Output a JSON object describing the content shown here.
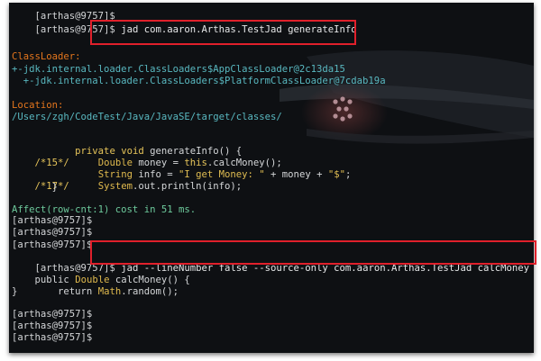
{
  "terminal": {
    "lines": [
      {
        "t": "[arthas@9757]$"
      },
      {
        "t": "[arthas@9757]$ jad com.aaron.Arthas.TestJad generateInfo"
      },
      {
        "t": ""
      },
      {
        "t": "ClassLoader:"
      },
      {
        "t": "+-jdk.internal.loader.ClassLoaders$AppClassLoader@2c13da15"
      },
      {
        "t": "  +-jdk.internal.loader.ClassLoaders$PlatformClassLoader@7cdab19a"
      },
      {
        "t": ""
      },
      {
        "t": "Location:"
      },
      {
        "t": "/Users/zgh/CodeTest/Java/JavaSE/target/classes/"
      },
      {
        "t": ""
      },
      {
        "t": "       private void generateInfo() {"
      },
      {
        "t": "/*15*/     Double money = this.calcMoney();"
      },
      {
        "t": "           String info = \"I get Money: \" + money + \"$\";"
      },
      {
        "t": "/*17*/     System.out.println(info);"
      },
      {
        "t": "       }"
      },
      {
        "t": ""
      },
      {
        "t": "Affect(row-cnt:1) cost in 51 ms."
      },
      {
        "t": "[arthas@9757]$"
      },
      {
        "t": "[arthas@9757]$"
      },
      {
        "t": "[arthas@9757]$"
      },
      {
        "t": "[arthas@9757]$ jad --lineNumber false --source-only com.aaron.Arthas.TestJad calcMoney"
      },
      {
        "t": "public Double calcMoney() {"
      },
      {
        "t": "    return Math.random();"
      },
      {
        "t": "}"
      },
      {
        "t": ""
      },
      {
        "t": "[arthas@9757]$"
      },
      {
        "t": "[arthas@9757]$"
      },
      {
        "t": "[arthas@9757]$"
      }
    ],
    "seg": {
      "prompt": "[arthas@9757]$",
      "cmd1": " jad com.aaron.Arthas.TestJad generateInfo",
      "classloader_label": "ClassLoader:",
      "cl1": "+-jdk.internal.loader.ClassLoaders$AppClassLoader@2c13da15",
      "cl2": "  +-jdk.internal.loader.ClassLoaders$PlatformClassLoader@7cdab19a",
      "location_label": "Location:",
      "location_path": "/Users/zgh/CodeTest/Java/JavaSE/target/classes/",
      "m_sig_pre": "       ",
      "m_sig_kw": "private void",
      "m_sig_rest": " generateInfo() {",
      "ln15": "/*15*/",
      "l15_pre": "     ",
      "l15_ty": "Double",
      "l15_a": " money = ",
      "l15_kw": "this",
      "l15_b": ".calcMoney();",
      "l16_pre": "           ",
      "l16_ty": "String",
      "l16_a": " info = ",
      "l16_s1": "\"I get Money: \"",
      "l16_b": " + money + ",
      "l16_s2": "\"$\"",
      "l16_c": ";",
      "ln17": "/*17*/",
      "l17_pre": "     ",
      "l17_ty": "System",
      "l17_a": ".out.println(info);",
      "close_method": "       }",
      "affect": "Affect(row-cnt:1) cost in 51 ms.",
      "cmd2": " jad --lineNumber false --source-only com.aaron.Arthas.TestJad calcMoney",
      "cm_kw": "public",
      "cm_sp": " ",
      "cm_ty": "Double",
      "cm_rest": " calcMoney() {",
      "ret_pre": "    ",
      "ret_kw": "return",
      "ret_sp": " ",
      "ret_ty": "Math",
      "ret_rest": ".random();",
      "close_brace": "}"
    },
    "colors": {
      "background": "#0e1013",
      "label_orange": "#e4761d",
      "path_teal": "#59b8c0",
      "keyword_yellow": "#e6c45a",
      "affect_green": "#6ecb9d",
      "highlight_red": "#e0202b"
    }
  }
}
